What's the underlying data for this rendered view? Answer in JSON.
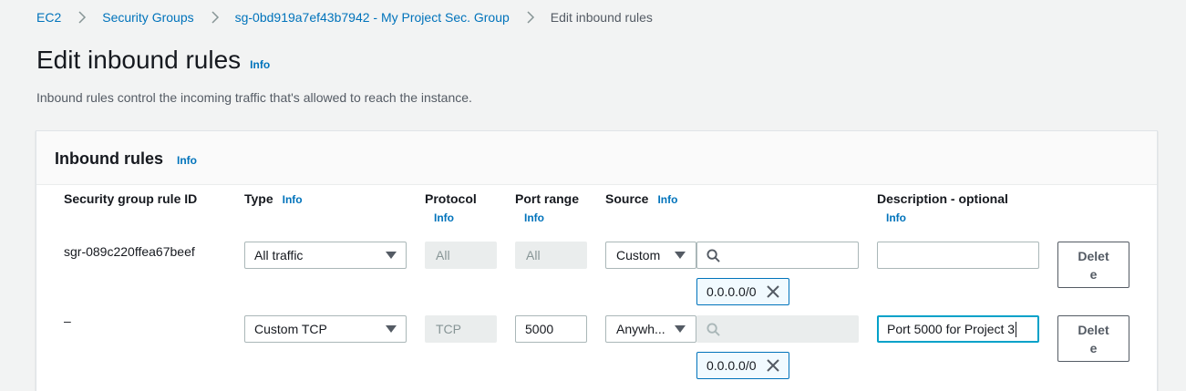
{
  "breadcrumb": {
    "items": [
      "EC2",
      "Security Groups",
      "sg-0bd919a7ef43b7942 - My Project Sec. Group"
    ],
    "current": "Edit inbound rules"
  },
  "page": {
    "title": "Edit inbound rules",
    "info": "Info",
    "description": "Inbound rules control the incoming traffic that's allowed to reach the instance."
  },
  "panel": {
    "title": "Inbound rules",
    "info": "Info",
    "columns": {
      "rule_id": "Security group rule ID",
      "type": "Type",
      "type_info": "Info",
      "protocol": "Protocol",
      "protocol_info": "Info",
      "port_range": "Port range",
      "port_range_info": "Info",
      "source": "Source",
      "source_info": "Info",
      "description": "Description - optional",
      "description_info": "Info"
    }
  },
  "rules": [
    {
      "rule_id": "sgr-089c220ffea67beef",
      "type": "All traffic",
      "protocol": "All",
      "port_range": "All",
      "source": "Custom",
      "source_search": "",
      "source_token": "0.0.0.0/0",
      "description": "",
      "delete_label": "Delete"
    },
    {
      "rule_id": "–",
      "type": "Custom TCP",
      "protocol": "TCP",
      "port_range": "5000",
      "source": "Anywh...",
      "source_search": "",
      "source_token": "0.0.0.0/0",
      "description": "Port 5000 for Project 3",
      "delete_label": "Delete"
    }
  ],
  "colors": {
    "link": "#0073bb",
    "focus": "#00a1c9",
    "token_bg": "#f1faff",
    "page_bg": "#f2f3f3"
  },
  "icons": {
    "separator": "chevron-right-icon",
    "search": "search-icon",
    "remove": "close-icon",
    "dropdown": "caret-down-icon"
  }
}
